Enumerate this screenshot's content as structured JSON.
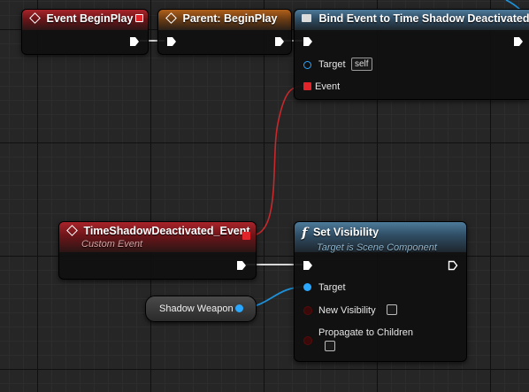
{
  "nodes": {
    "event_begin_play": {
      "title": "Event BeginPlay"
    },
    "parent_begin_play": {
      "title": "Parent: BeginPlay"
    },
    "bind_event": {
      "title": "Bind Event to Time Shadow Deactivated",
      "target_label": "Target",
      "target_default": "self",
      "event_label": "Event"
    },
    "custom_event": {
      "title": "TimeShadowDeactivated_Event",
      "subtitle": "Custom Event"
    },
    "set_visibility": {
      "title": "Set Visibility",
      "subtitle": "Target is Scene Component",
      "target_label": "Target",
      "new_visibility_label": "New Visibility",
      "new_visibility_value": false,
      "propagate_label": "Propagate to Children",
      "propagate_value": false
    },
    "shadow_weapon": {
      "label": "Shadow Weapon"
    }
  },
  "colors": {
    "exec_wire": "#ffffff",
    "delegate_wire": "#c8282c",
    "object_wire": "#1e90d8",
    "event_header": "#a8242a",
    "parent_header": "#b0601a",
    "function_header": "#4d7a9a",
    "bool_pin": "#5a0a0a",
    "object_pin": "#2aa7ff"
  },
  "icons": {
    "event_node": "event-diamond-icon",
    "function_node": "function-f-icon",
    "bind_node": "bind-delegate-icon"
  }
}
